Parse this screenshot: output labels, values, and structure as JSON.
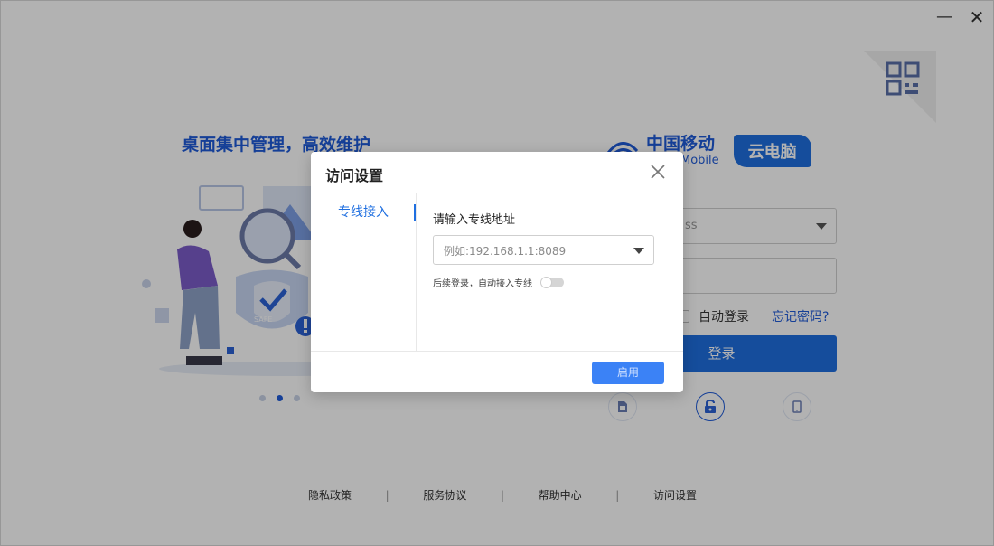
{
  "background": {
    "slogan": "桌面集中管理，高效维护",
    "brand": {
      "name_cn": "中国移动",
      "name_en": "Mobile",
      "product": "云电脑"
    },
    "login": {
      "account_fragment": "ss",
      "auto_login_label": "自动登录",
      "forgot_password": "忘记密码?",
      "login_button": "登录"
    },
    "footer": {
      "links": [
        "隐私政策",
        "服务协议",
        "帮助中心",
        "访问设置"
      ],
      "separator": "|"
    },
    "carousel_active_index": 1,
    "carousel_count": 3
  },
  "dialog": {
    "title": "访问设置",
    "tabs": [
      {
        "label": "专线接入",
        "active": true
      }
    ],
    "field_label": "请输入专线地址",
    "address_placeholder": "例如:192.168.1.1:8089",
    "toggle_label": "后续登录，自动接入专线",
    "toggle_on": false,
    "apply_button": "启用"
  },
  "colors": {
    "primary": "#1f6fe0",
    "brand_blue": "#1f5bd8",
    "overlay": "rgba(0,0,0,0.3)"
  }
}
